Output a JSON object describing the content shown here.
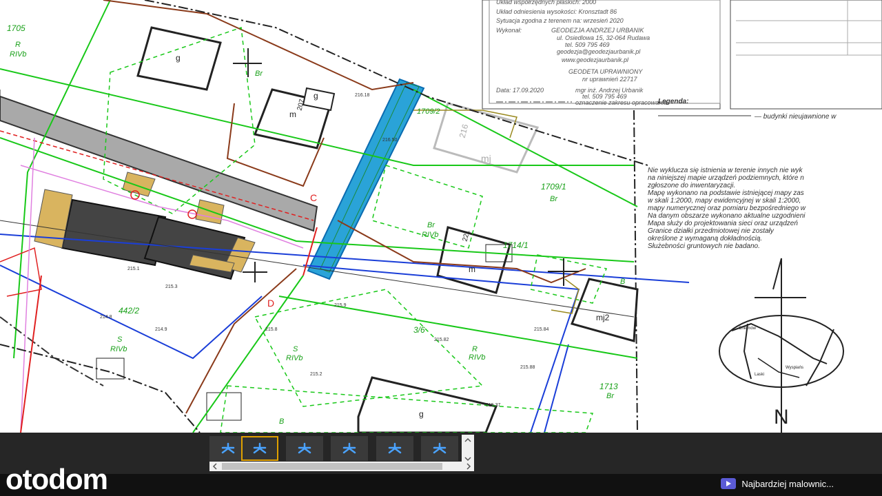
{
  "map": {
    "info_lines": [
      "Układ współrzędnych płaskich: 2000",
      "Układ odniesienia wysokości: Kronsztadt 86",
      "Sytuacja zgodna z terenem na: wrzesień 2020",
      "Wykonał:",
      "GEODEZJA ANDRZEJ URBANIK",
      "ul. Osiedlowa 15, 32-064 Rudawa",
      "tel. 509 795 469",
      "geodezja@geodezjaurbanik.pl",
      "www.geodezjaurbanik.pl",
      "GEODETA UPRAWNIONY",
      "nr uprawnień 22717",
      "Data: 17.09.2020",
      "mgr inż. Andrzej Urbanik",
      "tel. 509 795 469",
      "oznaczenie zakresu opracowania"
    ],
    "legend_title": "Legenda:",
    "legend_line": "— budynki nieujawnione w",
    "notes": [
      "Nie wyklucza się istnienia w terenie innych nie wyk",
      "na niniejszej mapie urządzeń podziemnych, które n",
      "zgłoszone do inwentaryzacji.",
      "Mapę wykonano na podstawie istniejącej mapy zas",
      "w skali 1:2000, mapy ewidencyjnej w skali 1:2000,",
      "mapy numerycznej oraz pomiaru bezpośredniego w",
      "Na danym obszarze wykonano aktualne uzgodnieni",
      "Mapa służy do projektowania sieci oraz urządzeń",
      "Granice działki przedmiotowej nie zostały",
      "określone z wymaganą dokładnością.",
      "Służebności gruntowych nie badano."
    ],
    "parcel_labels": [
      "1705",
      "1709/2",
      "1709/1",
      "1714/1",
      "442/2",
      "3/6",
      "1713"
    ],
    "use_labels": [
      "R",
      "RIVb",
      "Br",
      "S",
      "B"
    ],
    "building_labels": [
      "g",
      "m",
      "mj",
      "mj2",
      "207",
      "221",
      "216"
    ],
    "point_labels": [
      "C",
      "D"
    ],
    "heights": [
      "216.18",
      "215.9",
      "215.82",
      "215.88",
      "215.37",
      "214.9",
      "215.3",
      "215.1",
      "215.2",
      "214.8",
      "215.8",
      "215.84",
      "216.50"
    ],
    "north_label": "N",
    "locator_labels": [
      "Chełmów",
      "Wyspiańs",
      "Laski"
    ]
  },
  "thumbnails": [
    "pdf-icon",
    "pdf-icon",
    "pdf-icon",
    "pdf-icon",
    "pdf-icon",
    "pdf-icon"
  ],
  "active_thumbnail": 1,
  "brand": {
    "logo": "otodom"
  },
  "promo": {
    "text": "Najbardziej malownic..."
  },
  "colors": {
    "bar": "#262626",
    "active_border": "#e0a100",
    "pdf_icon": "#4aa3ff"
  }
}
